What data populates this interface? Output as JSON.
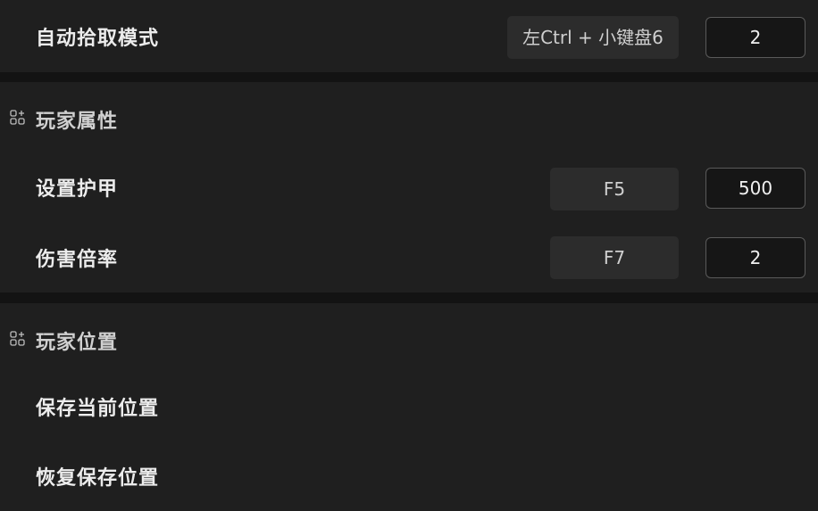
{
  "rows": {
    "auto_pickup": {
      "label": "自动拾取模式",
      "hotkey": "左Ctrl + 小键盘6",
      "value": "2"
    }
  },
  "sections": {
    "player_attributes": {
      "title": "玩家属性",
      "icon": "apps-add-icon",
      "items": [
        {
          "label": "设置护甲",
          "hotkey": "F5",
          "value": "500"
        },
        {
          "label": "伤害倍率",
          "hotkey": "F7",
          "value": "2"
        }
      ]
    },
    "player_position": {
      "title": "玩家位置",
      "icon": "apps-add-icon",
      "items": [
        {
          "label": "保存当前位置"
        },
        {
          "label": "恢复保存位置"
        }
      ]
    }
  },
  "colors": {
    "background": "#1f1f1f",
    "separator": "#131313",
    "hotkey_bg": "#2c2c2c",
    "input_bg": "#161616",
    "input_border": "#5a5a5a"
  }
}
